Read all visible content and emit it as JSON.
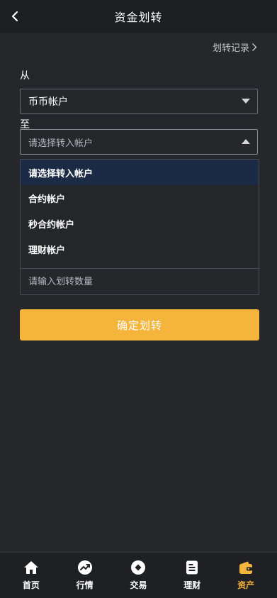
{
  "header": {
    "title": "资金划转"
  },
  "history_link": "划转记录",
  "form": {
    "from_label": "从",
    "from_value": "币币帐户",
    "to_label": "至",
    "to_placeholder": "请选择转入帐户",
    "options": [
      "请选择转入帐户",
      "合约帐户",
      "秒合约帐户",
      "理财帐户"
    ],
    "selected_option": "请选择转入帐户",
    "amount_placeholder": "请输入划转数量",
    "confirm_label": "确定划转"
  },
  "tabbar": {
    "active": "资产",
    "accent_color": "#f5b43c",
    "tabs": [
      {
        "label": "首页",
        "icon": "home-icon"
      },
      {
        "label": "行情",
        "icon": "trend-icon"
      },
      {
        "label": "交易",
        "icon": "trade-icon"
      },
      {
        "label": "理财",
        "icon": "finance-icon"
      },
      {
        "label": "资产",
        "icon": "wallet-icon"
      }
    ]
  }
}
